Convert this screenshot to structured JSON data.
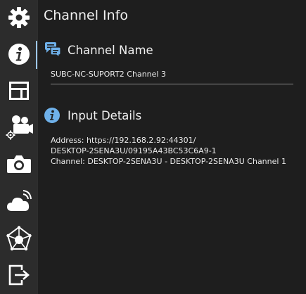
{
  "page": {
    "title": "Channel Info"
  },
  "sidebar": {
    "items": [
      {
        "id": "settings",
        "icon": "gear-icon",
        "active": false
      },
      {
        "id": "info",
        "icon": "info-icon",
        "active": true
      },
      {
        "id": "layout",
        "icon": "layout-icon",
        "active": false
      },
      {
        "id": "camera-settings",
        "icon": "video-camera-gear-icon",
        "active": false
      },
      {
        "id": "snapshot",
        "icon": "camera-icon",
        "active": false
      },
      {
        "id": "cloud",
        "icon": "cloud-signal-icon",
        "active": false
      },
      {
        "id": "network",
        "icon": "network-pentagon-icon",
        "active": false
      },
      {
        "id": "exit",
        "icon": "exit-icon",
        "active": false
      }
    ]
  },
  "channel_name": {
    "heading": "Channel Name",
    "value": "SUBC-NC-SUPORT2 Channel 3"
  },
  "input_details": {
    "heading": "Input Details",
    "address_line1": "Address: https://192.168.2.92:44301/",
    "address_line2": "DESKTOP-2SENA3U/09195A43BC53C6A9-1",
    "channel_line": "Channel: DESKTOP-2SENA3U - DESKTOP-2SENA3U Channel 1"
  },
  "colors": {
    "accent": "#6fb1ea",
    "background": "#1e1e1e",
    "sidebar": "#2c2c2c"
  }
}
